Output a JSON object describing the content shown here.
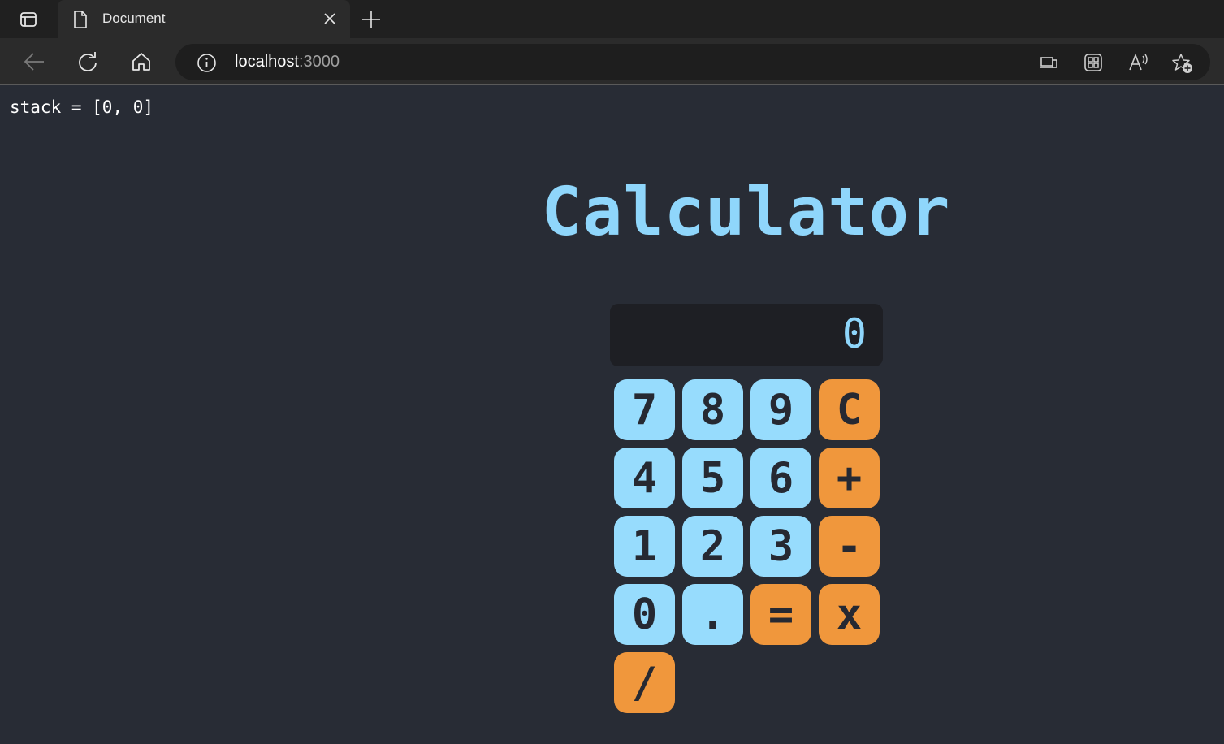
{
  "browser": {
    "tab": {
      "title": "Document"
    },
    "address": {
      "host": "localhost",
      "port": ":3000"
    }
  },
  "page": {
    "stack_text": "stack = [0, 0]",
    "title": "Calculator",
    "display_value": "0",
    "keys": [
      {
        "label": "7",
        "kind": "num"
      },
      {
        "label": "8",
        "kind": "num"
      },
      {
        "label": "9",
        "kind": "num"
      },
      {
        "label": "C",
        "kind": "op"
      },
      {
        "label": "4",
        "kind": "num"
      },
      {
        "label": "5",
        "kind": "num"
      },
      {
        "label": "6",
        "kind": "num"
      },
      {
        "label": "+",
        "kind": "op"
      },
      {
        "label": "1",
        "kind": "num"
      },
      {
        "label": "2",
        "kind": "num"
      },
      {
        "label": "3",
        "kind": "num"
      },
      {
        "label": "-",
        "kind": "op"
      },
      {
        "label": "0",
        "kind": "num"
      },
      {
        "label": ".",
        "kind": "num"
      },
      {
        "label": "=",
        "kind": "op"
      },
      {
        "label": "x",
        "kind": "op"
      },
      {
        "label": "/",
        "kind": "op"
      }
    ]
  },
  "colors": {
    "page_background": "#282c35",
    "accent_blue": "#8fd6fb",
    "key_number": "#97dcfd",
    "key_operator": "#f0973c",
    "display_background": "#1e1f24"
  },
  "icons": {
    "tab_actions": "tab-actions-icon",
    "tab_page": "page-icon",
    "tab_close": "close-icon",
    "new_tab": "plus-icon",
    "back": "back-arrow-icon",
    "refresh": "refresh-icon",
    "home": "home-icon",
    "site_info": "info-icon",
    "app_available": "app-available-icon",
    "extensions": "extensions-icon",
    "read_aloud": "read-aloud-icon",
    "favorites": "add-favorite-icon"
  }
}
